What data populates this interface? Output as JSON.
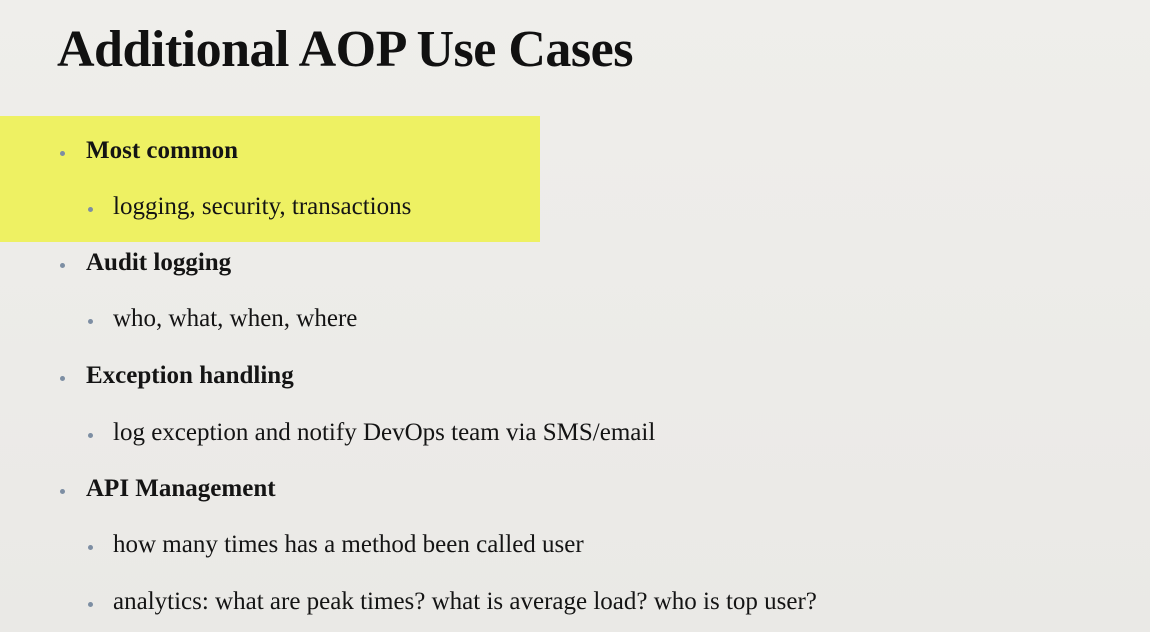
{
  "slide": {
    "title": "Additional AOP Use Cases",
    "highlight_color": "#eef163",
    "bullet_color": "#7d8ea3",
    "items": [
      {
        "level": 1,
        "text": "Most common",
        "highlighted": true
      },
      {
        "level": 2,
        "text": "logging, security, transactions",
        "highlighted": true
      },
      {
        "level": 1,
        "text": "Audit logging"
      },
      {
        "level": 2,
        "text": "who, what, when, where"
      },
      {
        "level": 1,
        "text": "Exception handling"
      },
      {
        "level": 2,
        "text": "log exception and notify DevOps team via SMS/email"
      },
      {
        "level": 1,
        "text": "API Management"
      },
      {
        "level": 2,
        "text": "how many times has a method been called user"
      },
      {
        "level": 2,
        "text": "analytics: what are peak times? what is average load?  who is top user?"
      }
    ]
  }
}
